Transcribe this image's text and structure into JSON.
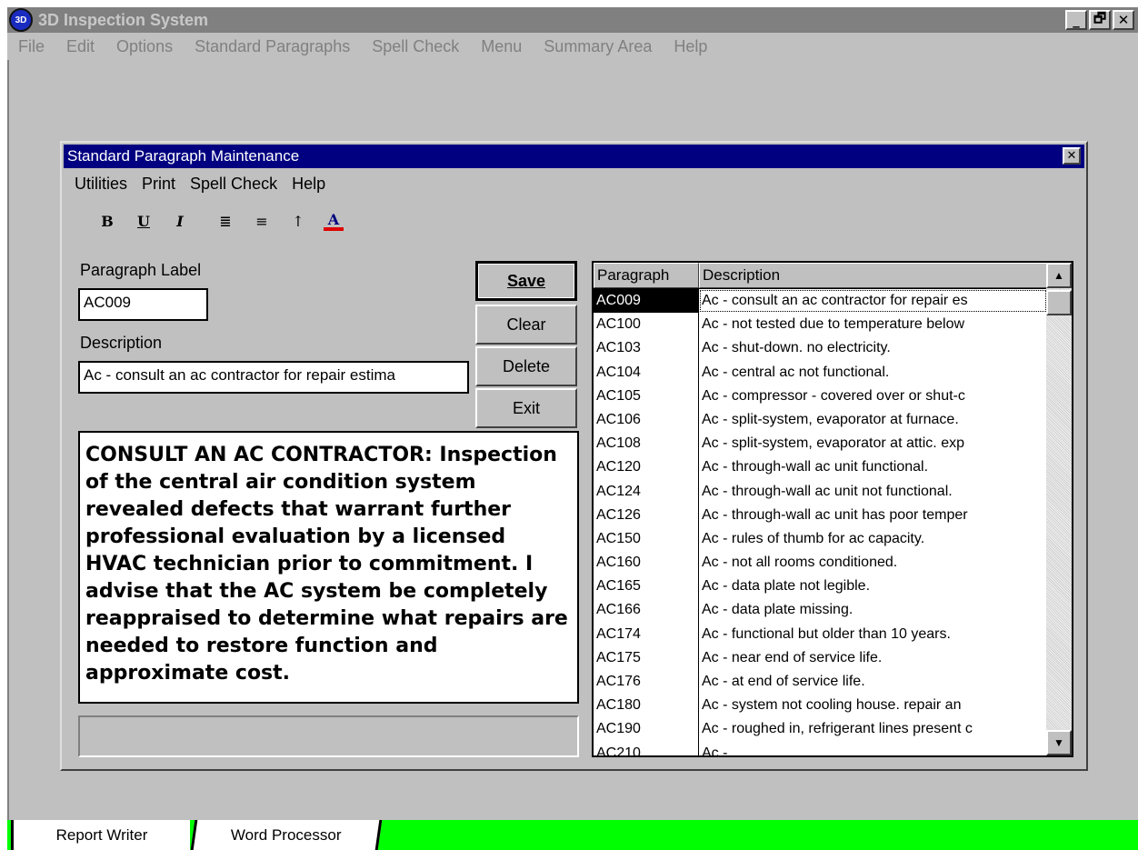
{
  "app": {
    "title": "3D Inspection System",
    "icon_text": "3D",
    "window_buttons": {
      "minimize": "_",
      "restore": "🗗",
      "close": "✕"
    },
    "menu": [
      "File",
      "Edit",
      "Options",
      "Standard Paragraphs",
      "Spell Check",
      "Menu",
      "Summary Area",
      "Help"
    ]
  },
  "dialog": {
    "title": "Standard Paragraph Maintenance",
    "close": "✕",
    "menu": [
      "Utilities",
      "Print",
      "Spell Check",
      "Help"
    ],
    "toolbar": {
      "bold": "B",
      "underline": "U",
      "italic": "I",
      "align_left": "≣",
      "align_center": "≡",
      "superscript": "↑",
      "font_color": "A"
    },
    "paragraph_label_caption": "Paragraph Label",
    "paragraph_label_value": "AC009",
    "description_caption": "Description",
    "description_value": "Ac - consult an ac contractor for repair estima",
    "buttons": {
      "save": "Save",
      "clear": "Clear",
      "delete": "Delete",
      "exit": "Exit"
    },
    "paragraph_text": "CONSULT AN AC CONTRACTOR: Inspection of the central air condition system revealed defects that warrant further professional evaluation by a licensed HVAC technician prior to commitment.  I advise that the AC system be completely reappraised to determine what repairs are needed to restore function and approximate cost.",
    "list": {
      "headers": [
        "Paragraph",
        "Description"
      ],
      "rows": [
        [
          "AC009",
          "Ac - consult an ac contractor for repair es"
        ],
        [
          "AC100",
          "Ac - not tested due to temperature below"
        ],
        [
          "AC103",
          "Ac - shut-down.  no electricity."
        ],
        [
          "AC104",
          "Ac - central ac not functional."
        ],
        [
          "AC105",
          "Ac - compressor - covered over or shut-c"
        ],
        [
          "AC106",
          "Ac - split-system, evaporator at furnace."
        ],
        [
          "AC108",
          "Ac - split-system, evaporator at attic.  exp"
        ],
        [
          "AC120",
          "Ac - through-wall ac unit functional."
        ],
        [
          "AC124",
          "Ac - through-wall ac unit not functional."
        ],
        [
          "AC126",
          "Ac - through-wall ac unit has poor temper"
        ],
        [
          "AC150",
          "Ac - rules of thumb for ac capacity."
        ],
        [
          "AC160",
          "Ac - not all rooms conditioned."
        ],
        [
          "AC165",
          "Ac - data plate not legible."
        ],
        [
          "AC166",
          "Ac - data plate missing."
        ],
        [
          "AC174",
          "Ac - functional but older than 10 years."
        ],
        [
          "AC175",
          "Ac - near end of service life."
        ],
        [
          "AC176",
          "Ac - at end of service life."
        ],
        [
          "AC180",
          "Ac - system not cooling house.  repair an"
        ],
        [
          "AC190",
          "Ac - roughed in, refrigerant lines present c"
        ],
        [
          "AC210",
          "Ac - ..."
        ]
      ],
      "scroll_up": "▲",
      "scroll_down": "▼"
    }
  },
  "tabs": [
    "Report Writer",
    "Word Processor"
  ]
}
